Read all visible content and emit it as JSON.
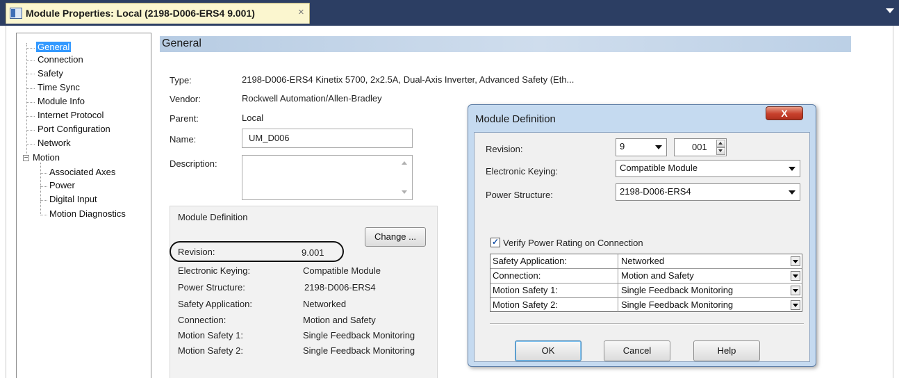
{
  "tab": {
    "title": "Module Properties: Local (2198-D006-ERS4 9.001)",
    "close": "×"
  },
  "nav": {
    "items": [
      "General",
      "Connection",
      "Safety",
      "Time Sync",
      "Module Info",
      "Internet Protocol",
      "Port Configuration",
      "Network",
      "Motion"
    ],
    "motion_children": [
      "Associated Axes",
      "Power",
      "Digital Input",
      "Motion Diagnostics"
    ],
    "expander": "−"
  },
  "general": {
    "header": "General",
    "type_label": "Type:",
    "type_value": "2198-D006-ERS4 Kinetix 5700, 2x2.5A, Dual-Axis Inverter, Advanced Safety (Eth...",
    "vendor_label": "Vendor:",
    "vendor_value": "Rockwell Automation/Allen-Bradley",
    "parent_label": "Parent:",
    "parent_value": "Local",
    "name_label": "Name:",
    "name_value": "UM_D006",
    "description_label": "Description:",
    "description_value": ""
  },
  "module_definition": {
    "title": "Module Definition",
    "change_button": "Change ...",
    "rows": [
      {
        "label": "Revision:",
        "value": "9.001"
      },
      {
        "label": "Electronic Keying:",
        "value": "Compatible Module"
      },
      {
        "label": "Power Structure:",
        "value": "2198-D006-ERS4"
      },
      {
        "label": "Safety Application:",
        "value": "Networked"
      },
      {
        "label": "Connection:",
        "value": "Motion and Safety"
      },
      {
        "label": "Motion Safety 1:",
        "value": "Single Feedback Monitoring"
      },
      {
        "label": "Motion Safety 2:",
        "value": "Single Feedback Monitoring"
      }
    ]
  },
  "dialog": {
    "title": "Module Definition",
    "close": "X",
    "revision_label": "Revision:",
    "revision_major": "9",
    "revision_minor": "001",
    "keying_label": "Electronic Keying:",
    "keying_value": "Compatible Module",
    "power_label": "Power Structure:",
    "power_value": "2198-D006-ERS4",
    "verify_checked": true,
    "verify_label": "Verify Power Rating on Connection",
    "grid": [
      {
        "label": "Safety Application:",
        "value": "Networked"
      },
      {
        "label": "Connection:",
        "value": "Motion and Safety"
      },
      {
        "label": "Motion Safety 1:",
        "value": "Single Feedback Monitoring"
      },
      {
        "label": "Motion Safety 2:",
        "value": "Single Feedback Monitoring"
      }
    ],
    "ok_button": "OK",
    "cancel_button": "Cancel",
    "help_button": "Help"
  },
  "colors": {
    "tabbar": "#2c3e63",
    "tab": "#fbf6cf",
    "selection": "#3399ff",
    "header_gradient": "#b7cce3",
    "dialog_frame": "#c5daf0",
    "close_button": "#c7402c"
  }
}
